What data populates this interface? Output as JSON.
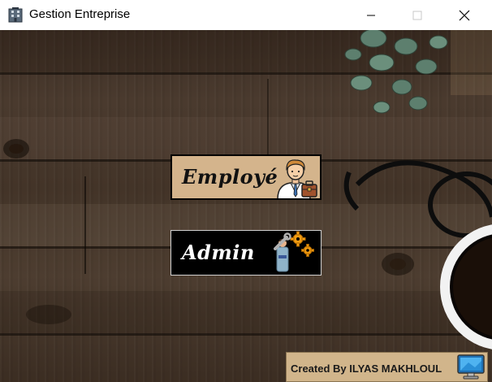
{
  "window": {
    "title": "Gestion Entreprise",
    "controls": [
      "minimize",
      "maximize",
      "close"
    ]
  },
  "buttons": {
    "employe_label": "Employé",
    "admin_label": "Admin"
  },
  "footer": {
    "credit": "Created By ILYAS MAKHLOUL"
  },
  "icons": {
    "app": "building-icon",
    "employe": "businessman-icon",
    "admin": "admin-gears-icon",
    "credit": "computer-monitor-icon"
  },
  "colors": {
    "employe_button_bg": "#d4b48c",
    "admin_button_bg": "#000000",
    "credit_bg": "#d1b58b",
    "wood": "#4a3a2e"
  }
}
